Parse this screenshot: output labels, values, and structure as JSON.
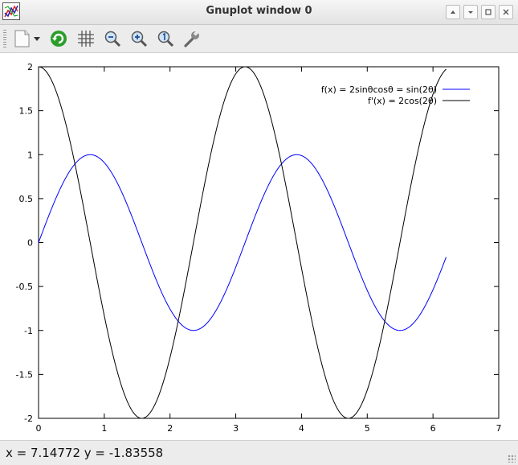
{
  "window": {
    "title": "Gnuplot window 0",
    "controls": [
      "up-icon",
      "minimize-icon",
      "maximize-icon",
      "close-icon"
    ]
  },
  "toolbar": {
    "tools": [
      {
        "name": "export-icon"
      },
      {
        "name": "replot-icon"
      },
      {
        "name": "grid-icon"
      },
      {
        "name": "zoom-previous-icon"
      },
      {
        "name": "zoom-next-icon"
      },
      {
        "name": "autoscale-icon"
      },
      {
        "name": "options-icon"
      }
    ]
  },
  "status": {
    "text": "x = 7.14772 y = -1.83558"
  },
  "colors": {
    "series1": "#0000ff",
    "series2": "#000000",
    "accent_green": "#2a9d2a"
  },
  "chart_data": {
    "type": "line",
    "xlim": [
      0,
      7
    ],
    "ylim": [
      -2,
      2
    ],
    "xticks": [
      0,
      1,
      2,
      3,
      4,
      5,
      6,
      7
    ],
    "yticks": [
      2,
      1.5,
      1,
      0.5,
      0,
      -0.5,
      -1,
      -1.5,
      -2
    ],
    "xtick_labels": [
      "0",
      "1",
      "2",
      "3",
      "4",
      "5",
      "6",
      "7"
    ],
    "ytick_labels": [
      "2",
      "1.5",
      "1",
      "0.5",
      "0",
      "-0.5",
      "-1",
      "-1.5",
      "-2"
    ],
    "grid": false,
    "legend": "top-right",
    "x_range": [
      0,
      6.2
    ],
    "series": [
      {
        "name": "f(x) = 2sinθcosθ = sin(2θ)",
        "color": "#0000ff",
        "x": [
          0,
          0.2,
          0.4,
          0.6,
          0.8,
          1.0,
          1.2,
          1.4,
          1.6,
          1.8,
          2.0,
          2.2,
          2.4,
          2.6,
          2.8,
          3.0,
          3.2,
          3.4,
          3.6,
          3.8,
          4.0,
          4.2,
          4.4,
          4.6,
          4.8,
          5.0,
          5.2,
          5.4,
          5.6,
          5.8,
          6.0,
          6.2
        ],
        "y": [
          0,
          0.389,
          0.717,
          0.932,
          1.0,
          0.909,
          0.675,
          0.335,
          -0.058,
          -0.443,
          -0.757,
          -0.952,
          -0.996,
          -0.883,
          -0.631,
          -0.279,
          0.117,
          0.494,
          0.794,
          0.968,
          0.989,
          0.855,
          0.585,
          0.223,
          -0.175,
          -0.544,
          -0.828,
          -0.981,
          -0.98,
          -0.823,
          -0.537,
          -0.165
        ]
      },
      {
        "name": "f'(x) = 2cos(2θ)",
        "color": "#000000",
        "x": [
          0,
          0.2,
          0.4,
          0.6,
          0.8,
          1.0,
          1.2,
          1.4,
          1.6,
          1.8,
          2.0,
          2.2,
          2.4,
          2.6,
          2.8,
          3.0,
          3.2,
          3.4,
          3.6,
          3.8,
          4.0,
          4.2,
          4.4,
          4.6,
          4.8,
          5.0,
          5.2,
          5.4,
          5.6,
          5.8,
          6.0,
          6.2
        ],
        "y": [
          2.0,
          1.842,
          1.393,
          0.725,
          -0.058,
          -0.832,
          -1.475,
          -1.884,
          -1.997,
          -1.793,
          -1.307,
          -0.617,
          0.175,
          0.936,
          1.551,
          1.92,
          1.986,
          1.739,
          1.216,
          0.506,
          -0.291,
          -1.035,
          -1.621,
          -1.95,
          -1.969,
          -1.678,
          -1.121,
          -0.39,
          0.405,
          1.129,
          1.688,
          1.97
        ]
      }
    ]
  }
}
